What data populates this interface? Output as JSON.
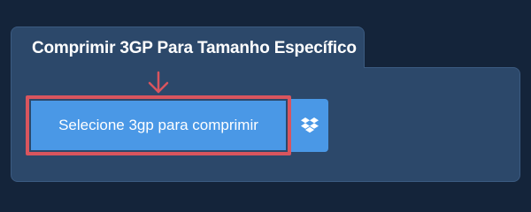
{
  "panel": {
    "title": "Comprimir 3GP Para Tamanho Específico"
  },
  "upload": {
    "select_label": "Selecione 3gp para comprimir",
    "dropbox_icon": "dropbox-icon"
  },
  "colors": {
    "background": "#14243a",
    "panel": "#2c486a",
    "button": "#4a98e6",
    "highlight": "#d9555e",
    "text": "#ffffff"
  }
}
